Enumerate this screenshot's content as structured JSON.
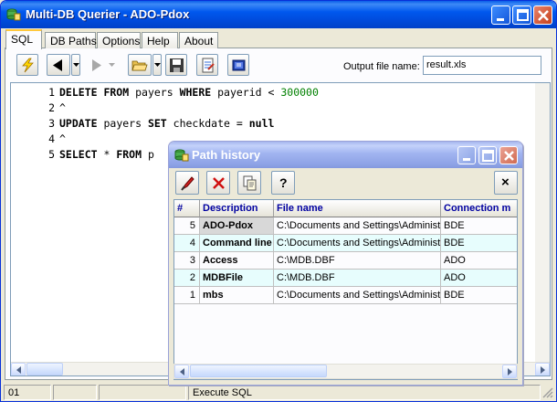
{
  "app": {
    "title": "Multi-DB Querier - ADO-Pdox"
  },
  "tabs": [
    {
      "label": "SQL",
      "active": true
    },
    {
      "label": "DB Paths"
    },
    {
      "label": "Options"
    },
    {
      "label": "Help"
    },
    {
      "label": "About"
    }
  ],
  "toolbar": {
    "icons": [
      "lightning-icon",
      "back-icon",
      "forward-icon",
      "open-folder-icon",
      "save-icon",
      "export-icon",
      "db-icon"
    ],
    "output_label": "Output file name:",
    "output_value": "result.xls"
  },
  "editor": {
    "lines": [
      {
        "num": "1",
        "parts": [
          [
            "kw",
            "DELETE FROM "
          ],
          [
            "",
            "payers "
          ],
          [
            "kw",
            "WHERE "
          ],
          [
            "",
            "payerid < "
          ],
          [
            "num",
            "300000"
          ]
        ]
      },
      {
        "num": "2",
        "parts": [
          [
            "",
            "^"
          ]
        ]
      },
      {
        "num": "3",
        "parts": [
          [
            "kw",
            "UPDATE "
          ],
          [
            "",
            "payers "
          ],
          [
            "kw",
            "SET "
          ],
          [
            "",
            "checkdate = "
          ],
          [
            "kw",
            "null"
          ]
        ]
      },
      {
        "num": "4",
        "parts": [
          [
            "",
            "^"
          ]
        ]
      },
      {
        "num": "5",
        "parts": [
          [
            "kw",
            "SELECT "
          ],
          [
            "",
            "* "
          ],
          [
            "kw",
            "FROM "
          ],
          [
            "",
            "p"
          ]
        ]
      }
    ]
  },
  "status": {
    "cell1": "01",
    "cell2": "",
    "cell3": "",
    "message": "Execute SQL"
  },
  "popup": {
    "title": "Path history",
    "buttons": [
      "paint-icon",
      "delete-icon",
      "copy-icon",
      "help-icon"
    ],
    "help_label": "?",
    "close_label": "×",
    "columns": [
      "#",
      "Description",
      "File name",
      "Connection m"
    ],
    "rows": [
      {
        "idx": "5",
        "desc": "ADO-Pdox",
        "file": "C:\\Documents and Settings\\Administr",
        "conn": "BDE",
        "selected": true
      },
      {
        "idx": "4",
        "desc": "Command line",
        "file": "C:\\Documents and Settings\\Administr",
        "conn": "BDE"
      },
      {
        "idx": "3",
        "desc": "Access",
        "file": "C:\\MDB.DBF",
        "conn": "ADO"
      },
      {
        "idx": "2",
        "desc": "MDBFile",
        "file": "C:\\MDB.DBF",
        "conn": "ADO"
      },
      {
        "idx": "1",
        "desc": "mbs",
        "file": "C:\\Documents and Settings\\Administr",
        "conn": "BDE"
      }
    ]
  },
  "colors": {
    "title_bar": "#0058ee",
    "tab_highlight": "#ffc83c",
    "keyword_number": "#008000",
    "grid_header_text": "#0000a0",
    "grid_alt_row": "#e7fdfd"
  }
}
